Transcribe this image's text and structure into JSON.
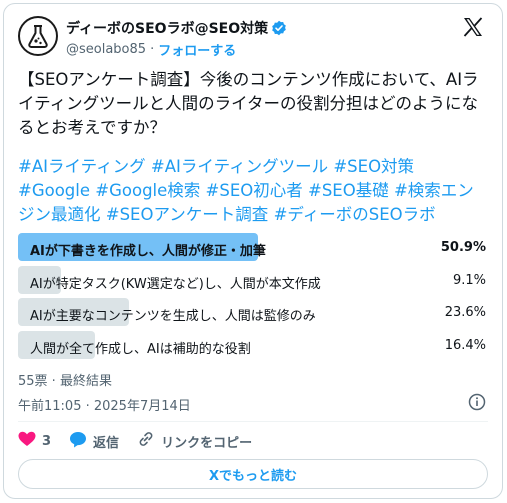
{
  "author": {
    "name": "ディーボのSEOラボ@SEO対策",
    "handle": "@seolabo85",
    "separator": "·",
    "follow_label": "フォローする"
  },
  "icons": {
    "avatar": "flask-logo-icon",
    "verified": "verified-badge-icon",
    "brand": "x-logo-icon",
    "info": "info-icon",
    "like": "heart-icon",
    "reply": "reply-icon",
    "copy_link": "link-icon"
  },
  "colors": {
    "accent": "#1d9bf0",
    "winner_bar": "#74c0f6",
    "poll_bar": "#cfd9de",
    "like": "#f91880",
    "muted_text": "#536471"
  },
  "tweet": {
    "text": "【SEOアンケート調査】今後のコンテンツ作成において、AIライティングツールと人間のライターの役割分担はどのようになるとお考えですか？",
    "hashtags": [
      "#AIライティング",
      "#AIライティングツール",
      "#SEO対策",
      "#Google",
      "#Google検索",
      "#SEO初心者",
      "#SEO基礎",
      "#検索エンジン最適化",
      "#SEOアンケート調査",
      "#ディーボのSEOラボ"
    ]
  },
  "poll": {
    "options": [
      {
        "label": "AIが下書きを作成し、人間が修正・加筆",
        "percent_text": "50.9%",
        "percent": 50.9,
        "winner": true
      },
      {
        "label": "AIが特定タスク(KW選定など)し、人間が本文作成",
        "percent_text": "9.1%",
        "percent": 9.1,
        "winner": false
      },
      {
        "label": "AIが主要なコンテンツを生成し、人間は監修のみ",
        "percent_text": "23.6%",
        "percent": 23.6,
        "winner": false
      },
      {
        "label": "人間が全て作成し、AIは補助的な役割",
        "percent_text": "16.4%",
        "percent": 16.4,
        "winner": false
      }
    ],
    "meta": "55票 · 最終結果"
  },
  "timestamp": "午前11:05 · 2025年7月14日",
  "actions": {
    "like_count": "3",
    "reply_label": "返信",
    "copy_link_label": "リンクをコピー"
  },
  "read_more_label": "Xでもっと読む"
}
